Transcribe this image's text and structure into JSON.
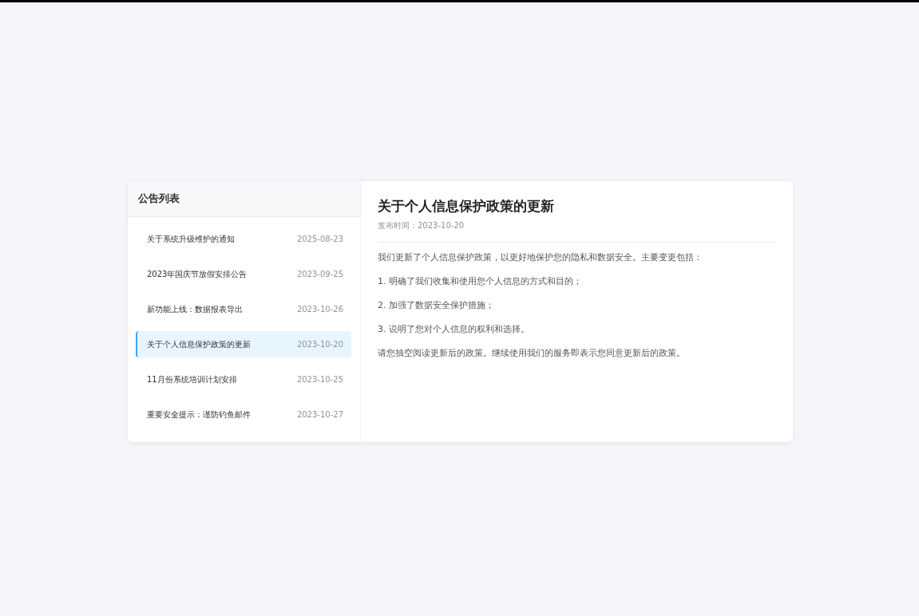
{
  "list_panel": {
    "title": "公告列表",
    "items": [
      {
        "title": "关于系统升级维护的通知",
        "date": "2025-08-23",
        "selected": false
      },
      {
        "title": "2023年国庆节放假安排公告",
        "date": "2023-09-25",
        "selected": false
      },
      {
        "title": "新功能上线：数据报表导出",
        "date": "2023-10-26",
        "selected": false
      },
      {
        "title": "关于个人信息保护政策的更新",
        "date": "2023-10-20",
        "selected": true
      },
      {
        "title": "11月份系统培训计划安排",
        "date": "2023-10-25",
        "selected": false
      },
      {
        "title": "重要安全提示：谨防钓鱼邮件",
        "date": "2023-10-27",
        "selected": false
      }
    ]
  },
  "detail": {
    "title": "关于个人信息保护政策的更新",
    "publish_label": "发布时间：2023-10-20",
    "paragraphs": [
      "我们更新了个人信息保护政策，以更好地保护您的隐私和数据安全。主要变更包括：",
      "1. 明确了我们收集和使用您个人信息的方式和目的；",
      "2. 加强了数据安全保护措施；",
      "3. 说明了您对个人信息的权利和选择。",
      "请您抽空阅读更新后的政策。继续使用我们的服务即表示您同意更新后的政策。"
    ]
  }
}
